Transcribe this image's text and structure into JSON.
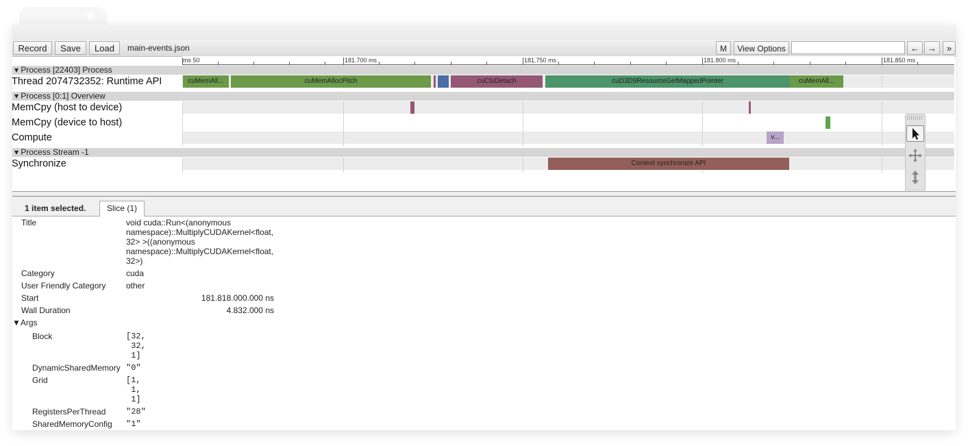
{
  "toolbar": {
    "record": "Record",
    "save": "Save",
    "load": "Load",
    "filename": "main-events.json",
    "m_button": "M",
    "view_options": "View Options",
    "nav_left": "←",
    "nav_right": "→",
    "more": "»"
  },
  "ruler": {
    "ticks": [
      "50 ms",
      "181.700 ms",
      "181.750 ms",
      "181.800 ms",
      "181.850 ms"
    ]
  },
  "process1": {
    "header": "▾ Process [22403] Process",
    "thread": "Thread 2074732352: Runtime API",
    "slices": [
      "cuMemAll...",
      "cuMemAllocPitch",
      "cuCtxDetach",
      "cuD3D9ResourceGetMappedPointer",
      "cuMemAll..."
    ]
  },
  "process2": {
    "header": "▾ Process [0:1] Overview",
    "rows": [
      "MemCpy (host to device)",
      "MemCpy (device to host)",
      "Compute"
    ],
    "compute_slice": "v..."
  },
  "process3": {
    "header": "▾ Process Stream -1",
    "row": "Synchronize",
    "slice": "Context synchronize API"
  },
  "panel": {
    "selected": "1 item selected.",
    "tab": "Slice (1)",
    "fields": {
      "title_label": "Title",
      "title_lines": [
        "void cuda::Run<(anonymous",
        "namespace)::MultiplyCUDAKernel<float,",
        "32> >((anonymous",
        "namespace)::MultiplyCUDAKernel<float,",
        "32>)"
      ],
      "category_label": "Category",
      "category": "cuda",
      "ufc_label": "User Friendly Category",
      "ufc": "other",
      "start_label": "Start",
      "start": "181.818.000.000 ns",
      "wall_label": "Wall Duration",
      "wall": "4.832.000 ns"
    },
    "args": {
      "header": "▼Args",
      "block_label": "Block",
      "block_lines": [
        "[32,",
        " 32,",
        " 1]"
      ],
      "dsm_label": "DynamicSharedMemory",
      "dsm": "\"0\"",
      "grid_label": "Grid",
      "grid_lines": [
        "[1,",
        " 1,",
        " 1]"
      ],
      "rpt_label": "RegistersPerThread",
      "rpt": "\"28\"",
      "smc_label": "SharedMemoryConfig",
      "smc": "\"1\""
    }
  },
  "colors": {
    "green": "#6b9a49",
    "mauve": "#945875",
    "blue": "#4a6da6",
    "teal": "#4c9469",
    "rust": "#945e5a",
    "lavender": "#b8a4c8",
    "bright_green": "#5ca64a"
  },
  "icons": [
    "select-arrow-icon",
    "pan-icon",
    "zoom-icon"
  ]
}
